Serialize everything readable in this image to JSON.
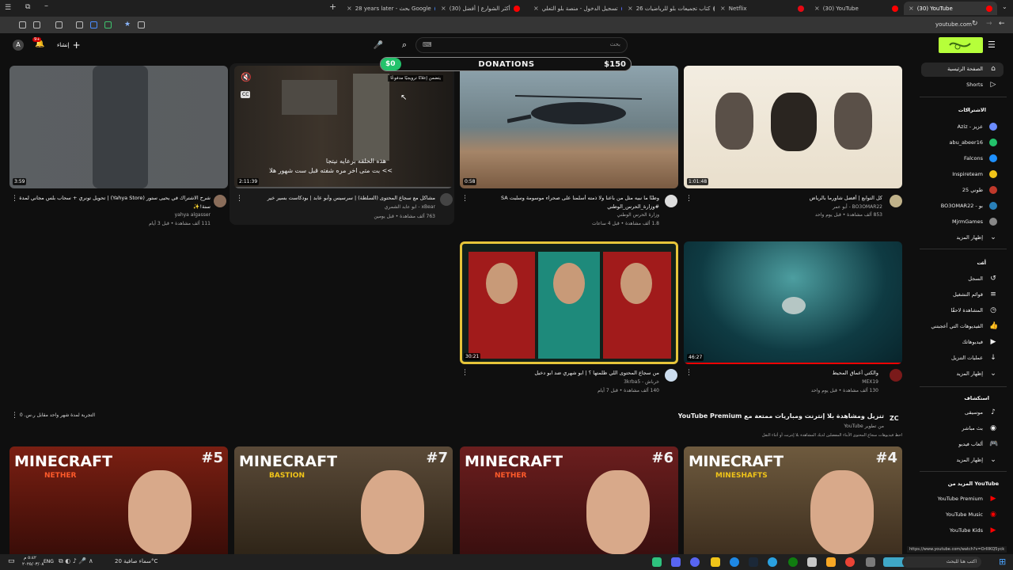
{
  "browser": {
    "tabs": [
      {
        "title": "28 years later - بحث Google",
        "fav": "#4285f4"
      },
      {
        "title": "أكثر الشوارع | أفضل (30)",
        "fav": "#ff0000"
      },
      {
        "title": "تسجيل الدخول - منصة بلو التعلي",
        "fav": "#5a6cff"
      },
      {
        "title": "كتاب تجميعات بلو للرياضيات 26",
        "fav": "#999999"
      },
      {
        "title": "Netflix",
        "fav": "#e50914"
      },
      {
        "title": "(30) YouTube",
        "fav": "#ff0000"
      },
      {
        "title": "(30) YouTube",
        "fav": "#ff0000"
      }
    ],
    "url": "youtube.com"
  },
  "header": {
    "search_placeholder": "بحث",
    "create_label": "إنشاء",
    "notif_count": "9+",
    "avatar_letter": "A"
  },
  "donation": {
    "current": "$0",
    "label": "DONATIONS",
    "goal": "$150",
    "progress": 0.0
  },
  "sidebar": {
    "main": [
      {
        "label": "الصفحة الرئيسية"
      },
      {
        "label": "Shorts"
      }
    ],
    "subs_title": "الاشتراكات",
    "subs": [
      {
        "label": "Aziz - عزيز",
        "color": "#6b8cff"
      },
      {
        "label": "abu_abeer16",
        "color": "#23c26b"
      },
      {
        "label": "Falcons",
        "color": "#1e90ff"
      },
      {
        "label": "Inspireteam",
        "color": "#f0c419"
      },
      {
        "label": "طوني 25",
        "color": "#c0392b"
      },
      {
        "label": "BO3OMAR22 - بو",
        "color": "#2980b9"
      },
      {
        "label": "MjrmGames",
        "color": "#888888"
      },
      {
        "label": "إظهار المزيد",
        "color": ""
      }
    ],
    "you_title": "أنت",
    "you": [
      {
        "label": "السجل"
      },
      {
        "label": "قوائم التشغيل"
      },
      {
        "label": "المشاهدة لاحقًا"
      },
      {
        "label": "الفيديوهات التي أعجبتني"
      },
      {
        "label": "فيديوهاتك"
      },
      {
        "label": "عمليات التنزيل"
      },
      {
        "label": "إظهار المزيد"
      }
    ],
    "explore_title": "استكشاف",
    "explore": [
      {
        "label": "موسيقى"
      },
      {
        "label": "بث مباشر"
      },
      {
        "label": "ألعاب فيديو"
      },
      {
        "label": "إظهار المزيد"
      }
    ],
    "more_title": "المزيد من YouTube",
    "more": [
      {
        "label": "YouTube Premium",
        "color": "#ff0000"
      },
      {
        "label": "YouTube Music",
        "color": "#ff0000"
      },
      {
        "label": "YouTube Kids",
        "color": "#ff0000"
      }
    ]
  },
  "videos_row1": [
    {
      "title": "كل التوابع | أفضل شاورما بالرياض",
      "title2": "",
      "channel": "BO3OMAR22 - أبو عمر",
      "meta": "853 ألف مشاهدة • قبل يوم واحد",
      "duration": "1:01:48"
    },
    {
      "title": "وطنًا ما نبيه مثل من باعنا ولا ذمته أسلمنا على صحراء موسومة وسلبت SA",
      "title2": "#وزارة_الحرس_الوطني",
      "channel": "وزارة الحرس الوطني",
      "meta": "1.8 ألف مشاهدة • قبل 4 ساعات",
      "duration": "0:58"
    },
    {
      "title": "مشاكل مع سجاع المحتوى (السلطة) | سرسيس وأبو عابد | بودكاست بسير خير",
      "title2": "",
      "channel": "xBear - ابو عابد الشمري",
      "meta": "763 ألف مشاهدة • قبل يومين",
      "duration": "2:11:39",
      "subtitle_overlay": "هذه الحلقه برعايه نيتجا",
      "subtitle_overlay2": ">> بت متى اخر مره شفته قبل ست شهور هلا",
      "autoplay_hint": "يتضمن إعلانًا ترويجيًا مدفوعًا"
    },
    {
      "title": "شرح الاشتراك في يحيى ستور (Yahya Store) | تحويل تونري + سحاب بلس مجاني لمدة",
      "title2": "سنة!✨",
      "channel": "yahya algasser",
      "meta": "111 ألف مشاهدة • قبل 3 أيام",
      "duration": "3:59"
    }
  ],
  "videos_row2": [
    {
      "title": "والكتي أعماق المحيط",
      "channel": "MEX19",
      "meta": "130 ألف مشاهدة • قبل يوم واحد",
      "duration": "46:27"
    },
    {
      "title": "من سجاع المحتوى اللي ظلمتها ؟ | ابو شهري ضد ابو دخيل",
      "channel": "خرباش - 3krba5",
      "meta": "140 ألف مشاهدة • قبل 7 أيام",
      "duration": "30:21"
    }
  ],
  "premium": {
    "badge": "ZC",
    "title": "تنزيل ومشاهدة بلا إنترنت ومباريات ممتعة مع YouTube Premium",
    "sub": "من تطوير YouTube",
    "desc": "احظ فيديوهات سجاع المحتوى الأبناء المفضلين لديك المشاهدة بلا إنترنت أو أثناء النقل",
    "cta": "التجربة لمدة شهر واحد مقابل ر.س. 0"
  },
  "minecraft": [
    {
      "num": "#4",
      "sub": "MINESHAFTS"
    },
    {
      "num": "#6",
      "sub": "NETHER"
    },
    {
      "num": "#7",
      "sub": "BASTION"
    },
    {
      "num": "#5",
      "sub": "NETHER"
    }
  ],
  "minecraft_word": "MINECRAFT",
  "taskbar": {
    "weather": "سماء صافية 20°C",
    "search": "اكتب هنا للبحث",
    "lang": "ENG",
    "time": "٥:٤٢ م",
    "date": "٢٠٢٥/٠٣/٠٨"
  },
  "status_url": "https://www.youtube.com/watch?v=OrIIIKQ5yck"
}
